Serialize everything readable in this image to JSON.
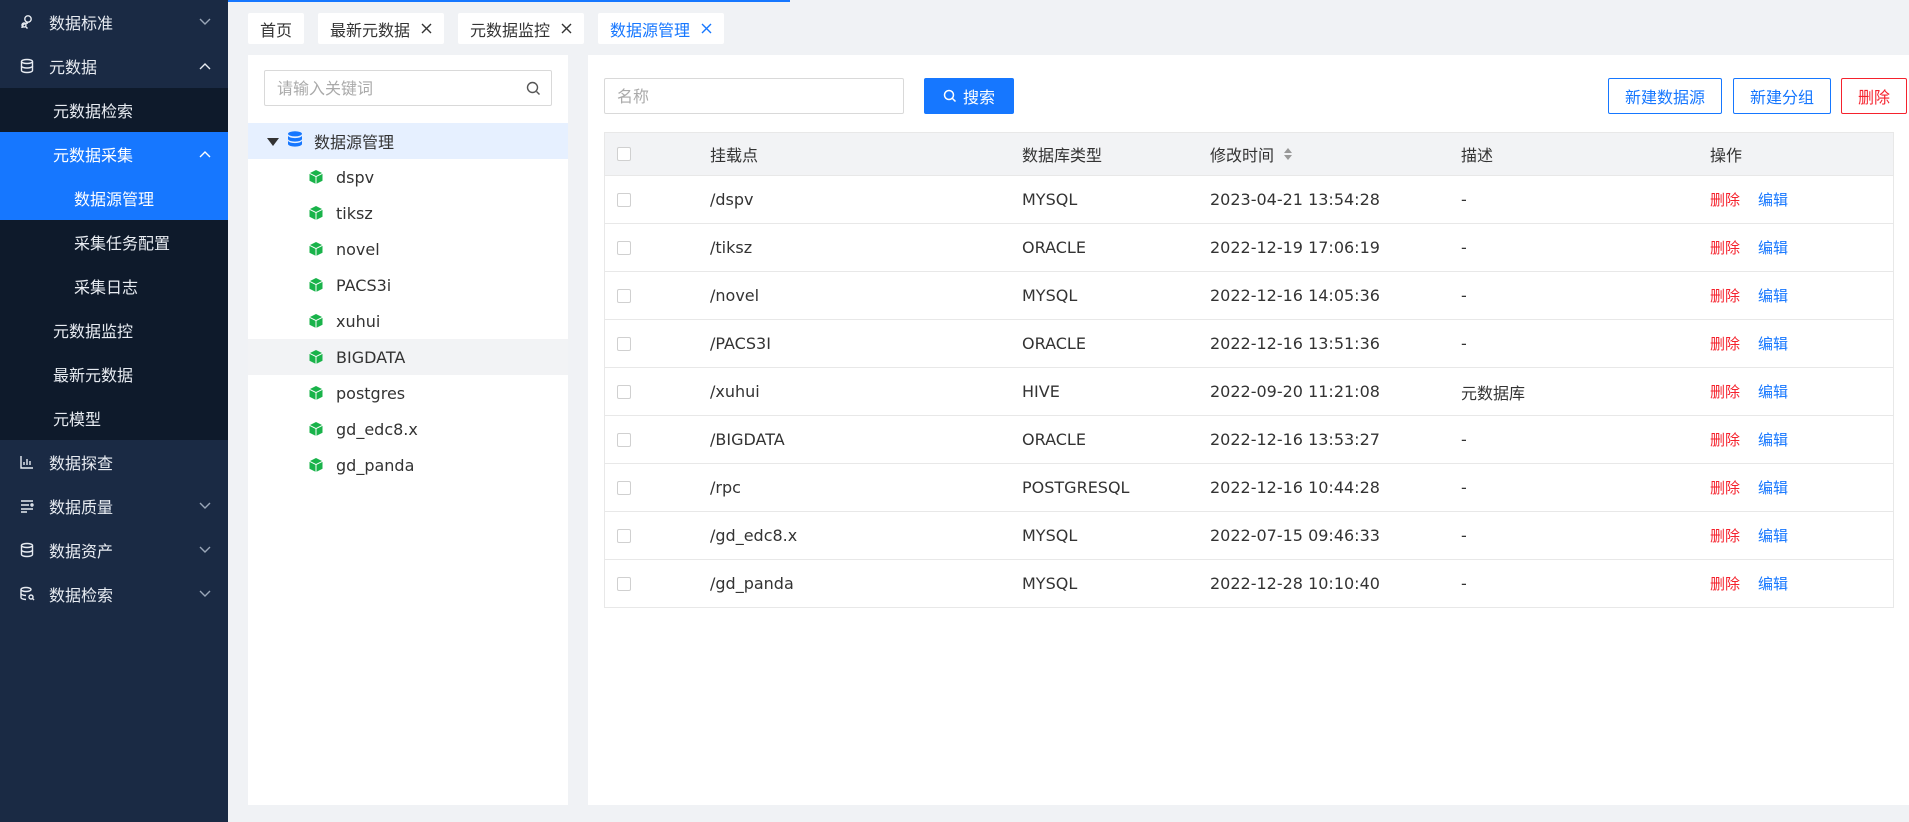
{
  "sidebar": {
    "items": [
      {
        "label": "数据标准",
        "icon": "person-search-icon",
        "chevron": "down"
      },
      {
        "label": "元数据",
        "icon": "database-icon",
        "chevron": "up"
      },
      {
        "label": "元数据检索"
      },
      {
        "label": "元数据采集",
        "chevron": "up"
      },
      {
        "label": "数据源管理"
      },
      {
        "label": "采集任务配置"
      },
      {
        "label": "采集日志"
      },
      {
        "label": "元数据监控"
      },
      {
        "label": "最新元数据"
      },
      {
        "label": "元模型"
      },
      {
        "label": "数据探查",
        "icon": "chart-icon"
      },
      {
        "label": "数据质量",
        "icon": "list-icon",
        "chevron": "down"
      },
      {
        "label": "数据资产",
        "icon": "database-icon",
        "chevron": "down"
      },
      {
        "label": "数据检索",
        "icon": "database-search-icon",
        "chevron": "down"
      }
    ]
  },
  "tabs": [
    {
      "label": "首页"
    },
    {
      "label": "最新元数据"
    },
    {
      "label": "元数据监控"
    },
    {
      "label": "数据源管理"
    }
  ],
  "tree": {
    "search_placeholder": "请输入关键词",
    "root_label": "数据源管理",
    "children": [
      "dspv",
      "tiksz",
      "novel",
      "PACS3i",
      "xuhui",
      "BIGDATA",
      "postgres",
      "gd_edc8.x",
      "gd_panda"
    ]
  },
  "toolbar": {
    "name_placeholder": "名称",
    "search_label": "搜索",
    "new_source_label": "新建数据源",
    "new_group_label": "新建分组",
    "delete_label": "删除"
  },
  "table": {
    "headers": {
      "mount": "挂载点",
      "type": "数据库类型",
      "time": "修改时间",
      "desc": "描述",
      "op": "操作"
    },
    "op_delete": "删除",
    "op_edit": "编辑",
    "rows": [
      {
        "mount": "/dspv",
        "type": "MYSQL",
        "time": "2023-04-21 13:54:28",
        "desc": "-"
      },
      {
        "mount": "/tiksz",
        "type": "ORACLE",
        "time": "2022-12-19 17:06:19",
        "desc": "-"
      },
      {
        "mount": "/novel",
        "type": "MYSQL",
        "time": "2022-12-16 14:05:36",
        "desc": "-"
      },
      {
        "mount": "/PACS3I",
        "type": "ORACLE",
        "time": "2022-12-16 13:51:36",
        "desc": "-"
      },
      {
        "mount": "/xuhui",
        "type": "HIVE",
        "time": "2022-09-20 11:21:08",
        "desc": "元数据库"
      },
      {
        "mount": "/BIGDATA",
        "type": "ORACLE",
        "time": "2022-12-16 13:53:27",
        "desc": "-"
      },
      {
        "mount": "/rpc",
        "type": "POSTGRESQL",
        "time": "2022-12-16 10:44:28",
        "desc": "-"
      },
      {
        "mount": "/gd_edc8.x",
        "type": "MYSQL",
        "time": "2022-07-15 09:46:33",
        "desc": "-"
      },
      {
        "mount": "/gd_panda",
        "type": "MYSQL",
        "time": "2022-12-28 10:10:40",
        "desc": "-"
      }
    ]
  },
  "colors": {
    "accent": "#1677ff",
    "danger": "#f5222d",
    "sidebar": "#1a2a44",
    "sidebar_sub": "#0e1a2b",
    "tree_icon": "#19b34a"
  }
}
